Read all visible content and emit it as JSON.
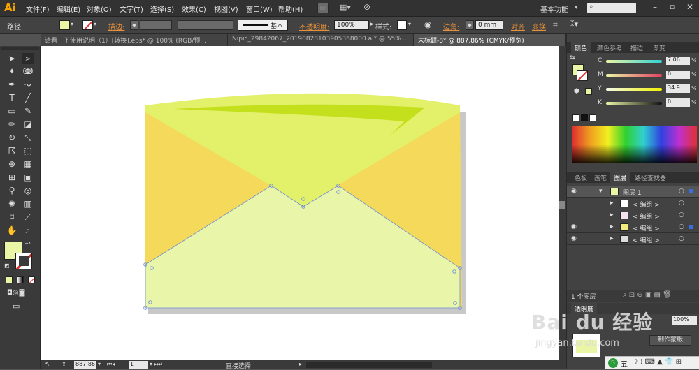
{
  "app": {
    "logo": "Ai",
    "workspace": "基本功能"
  },
  "menu": [
    "文件(F)",
    "编辑(E)",
    "对象(O)",
    "文字(T)",
    "选择(S)",
    "效果(C)",
    "视图(V)",
    "窗口(W)",
    "帮助(H)"
  ],
  "control_bar": {
    "selection_label": "路径",
    "stroke_label": "描边:",
    "stroke_style": "基本",
    "opacity_label": "不透明度:",
    "opacity_value": "100%",
    "style_label": "样式:",
    "corner_label": "边角:",
    "corner_value": "0 mm",
    "align_label": "对齐",
    "transform_label": "变换"
  },
  "doc_tabs": [
    {
      "label": "请看一下使用说明（1）[转换].eps* @ 100% (RGB/预..."
    },
    {
      "label": "Nipic_29842067_20190828103905368000.ai* @ 55%..."
    },
    {
      "label": "未标题-8* @ 887.86% (CMYK/预览)"
    }
  ],
  "color_panel": {
    "tabs": [
      "颜色",
      "颜色参考",
      "描边",
      "渐变"
    ],
    "channels": [
      {
        "name": "C",
        "value": "7.06",
        "unit": "%"
      },
      {
        "name": "M",
        "value": "0",
        "unit": "%"
      },
      {
        "name": "Y",
        "value": "34.9",
        "unit": "%"
      },
      {
        "name": "K",
        "value": "0",
        "unit": "%"
      }
    ]
  },
  "layers_panel": {
    "tabs": [
      "色板",
      "画笔",
      "图层",
      "路径查找器"
    ],
    "layer_name": "图层 1",
    "items": [
      "< 编组 >",
      "< 编组 >",
      "< 编组 >",
      "< 编组 >"
    ],
    "footer_count": "1 个图层"
  },
  "lower_panel": {
    "tab": "透明度",
    "opacity": "100%",
    "mask_button": "制作蒙版"
  },
  "status": {
    "zoom": "887.86",
    "page": "1",
    "tool": "直接选择"
  },
  "watermark": {
    "brand": "Bai du 经验",
    "url": "jingyan.baidu.com"
  },
  "taskbar": {
    "ime": "五"
  },
  "colors": {
    "fill": "#eaf6a6",
    "envelope_sides": "#f4d95a",
    "flap": "#e2f06a",
    "flap_shade": "#c4e01c",
    "body": "#e9f5a8"
  }
}
